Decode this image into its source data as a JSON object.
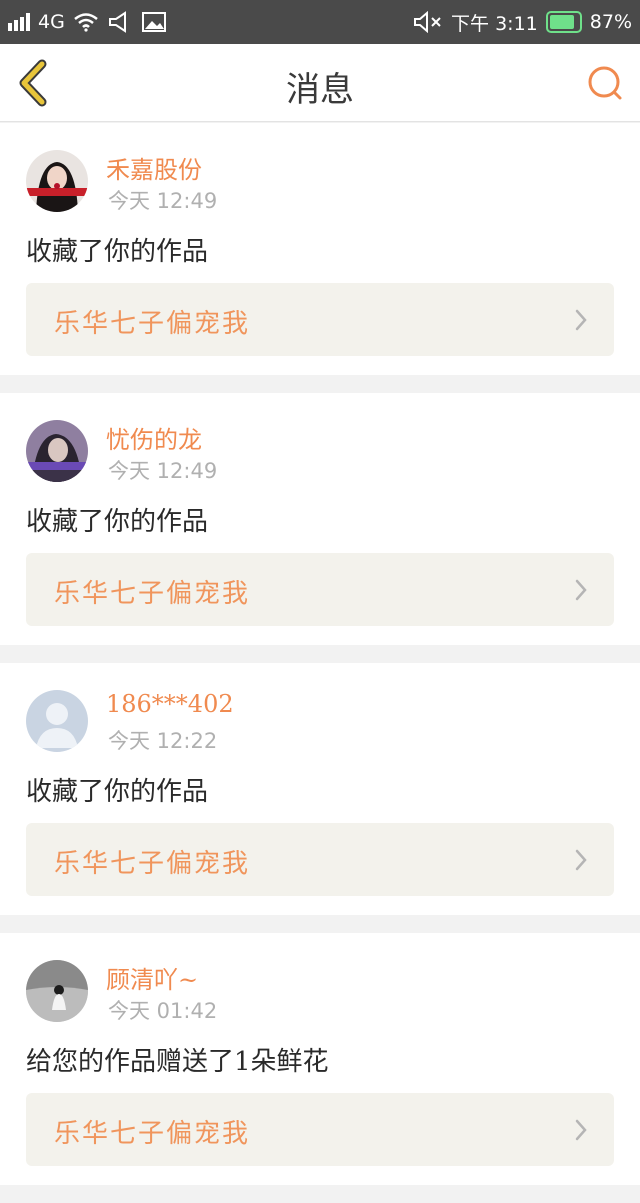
{
  "status_bar": {
    "network": "4G",
    "time": "下午 3:11",
    "battery": "87%",
    "battery_level": 0.87
  },
  "header": {
    "title": "消息",
    "back_icon": "chevron-left-icon",
    "search_icon": "search-icon"
  },
  "colors": {
    "accent": "#f08a4f",
    "back_arrow": "#e8c53a",
    "card_link_bg": "#f3f2ec"
  },
  "messages": [
    {
      "username": "禾嘉股份",
      "time": "今天 12:49",
      "text": "收藏了你的作品",
      "work_title": "乐华七子偏宠我",
      "avatar": "avatar-photo-red"
    },
    {
      "username": "忧伤的龙",
      "time": "今天 12:49",
      "text": "收藏了你的作品",
      "work_title": "乐华七子偏宠我",
      "avatar": "avatar-photo-purple"
    },
    {
      "username": "186***402",
      "time": "今天 12:22",
      "text": "收藏了你的作品",
      "work_title": "乐华七子偏宠我",
      "avatar": "avatar-default"
    },
    {
      "username": "顾清吖~",
      "time": "今天 01:42",
      "text": "给您的作品赠送了1朵鲜花",
      "work_title": "乐华七子偏宠我",
      "avatar": "avatar-photo-gray"
    }
  ]
}
